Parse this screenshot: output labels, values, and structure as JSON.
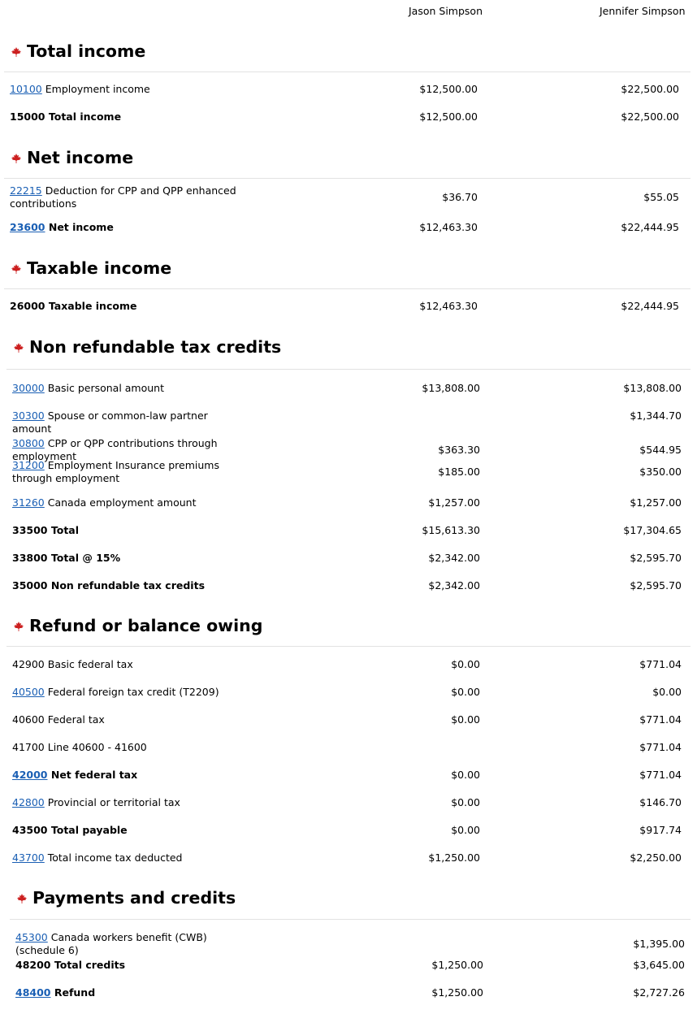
{
  "columns": {
    "person1": "Jason Simpson",
    "person2": "Jennifer Simpson"
  },
  "colors": {
    "maple_leaf": "#cc1f1f",
    "link": "#1a5fb4",
    "rule": "#e2e2e2"
  },
  "sections": [
    {
      "title": "Total income",
      "rows": [
        {
          "code": "10100",
          "linked": true,
          "label": "Employment income",
          "bold": false,
          "v1": "$12,500.00",
          "v2": "$22,500.00"
        },
        {
          "code": "15000",
          "linked": false,
          "label": "Total income",
          "bold": true,
          "v1": "$12,500.00",
          "v2": "$22,500.00"
        }
      ]
    },
    {
      "title": "Net income",
      "rows": [
        {
          "code": "22215",
          "linked": true,
          "label": "Deduction for CPP and QPP enhanced contributions",
          "bold": false,
          "v1": "$36.70",
          "v2": "$55.05"
        },
        {
          "code": "23600",
          "linked": true,
          "label": "Net income",
          "bold": true,
          "v1": "$12,463.30",
          "v2": "$22,444.95"
        }
      ]
    },
    {
      "title": "Taxable income",
      "rows": [
        {
          "code": "26000",
          "linked": false,
          "label": "Taxable income",
          "bold": true,
          "v1": "$12,463.30",
          "v2": "$22,444.95"
        }
      ]
    },
    {
      "title": "Non refundable tax credits",
      "rows": [
        {
          "code": "30000",
          "linked": true,
          "label": "Basic personal amount",
          "bold": false,
          "v1": "$13,808.00",
          "v2": "$13,808.00"
        },
        {
          "code": "30300",
          "linked": true,
          "label": "Spouse or common-law partner amount",
          "bold": false,
          "v1": "",
          "v2": "$1,344.70"
        },
        {
          "code": "30800",
          "linked": true,
          "label": "CPP or QPP contributions through employment",
          "bold": false,
          "v1": "$363.30",
          "v2": "$544.95"
        },
        {
          "code": "31200",
          "linked": true,
          "label": "Employment Insurance premiums through employment",
          "bold": false,
          "v1": "$185.00",
          "v2": "$350.00"
        },
        {
          "code": "31260",
          "linked": true,
          "label": "Canada employment amount",
          "bold": false,
          "v1": "$1,257.00",
          "v2": "$1,257.00"
        },
        {
          "code": "33500",
          "linked": false,
          "label": "Total",
          "bold": true,
          "v1": "$15,613.30",
          "v2": "$17,304.65"
        },
        {
          "code": "33800",
          "linked": false,
          "label": "Total @ 15%",
          "bold": true,
          "v1": "$2,342.00",
          "v2": "$2,595.70"
        },
        {
          "code": "35000",
          "linked": false,
          "label": "Non refundable tax credits",
          "bold": true,
          "v1": "$2,342.00",
          "v2": "$2,595.70"
        }
      ]
    },
    {
      "title": "Refund or balance owing",
      "rows": [
        {
          "code": "42900",
          "linked": false,
          "label": "Basic federal tax",
          "bold": false,
          "v1": "$0.00",
          "v2": "$771.04"
        },
        {
          "code": "40500",
          "linked": true,
          "label": "Federal foreign tax credit (T2209)",
          "bold": false,
          "v1": "$0.00",
          "v2": "$0.00"
        },
        {
          "code": "40600",
          "linked": false,
          "label": "Federal tax",
          "bold": false,
          "v1": "$0.00",
          "v2": "$771.04"
        },
        {
          "code": "41700",
          "linked": false,
          "label": "Line 40600 - 41600",
          "bold": false,
          "v1": "",
          "v2": "$771.04"
        },
        {
          "code": "42000",
          "linked": true,
          "label": "Net federal tax",
          "bold": true,
          "v1": "$0.00",
          "v2": "$771.04"
        },
        {
          "code": "42800",
          "linked": true,
          "label": "Provincial or territorial tax",
          "bold": false,
          "v1": "$0.00",
          "v2": "$146.70"
        },
        {
          "code": "43500",
          "linked": false,
          "label": "Total payable",
          "bold": true,
          "v1": "$0.00",
          "v2": "$917.74"
        },
        {
          "code": "43700",
          "linked": true,
          "label": "Total income tax deducted",
          "bold": false,
          "v1": "$1,250.00",
          "v2": "$2,250.00"
        }
      ]
    },
    {
      "title": "Payments and credits",
      "rows": [
        {
          "code": "45300",
          "linked": true,
          "label": "Canada workers benefit (CWB) (schedule 6)",
          "bold": false,
          "v1": "",
          "v2": "$1,395.00"
        },
        {
          "code": "48200",
          "linked": false,
          "label": "Total credits",
          "bold": true,
          "v1": "$1,250.00",
          "v2": "$3,645.00"
        },
        {
          "code": "48400",
          "linked": true,
          "label": "Refund",
          "bold": true,
          "v1": "$1,250.00",
          "v2": "$2,727.26"
        }
      ]
    }
  ]
}
